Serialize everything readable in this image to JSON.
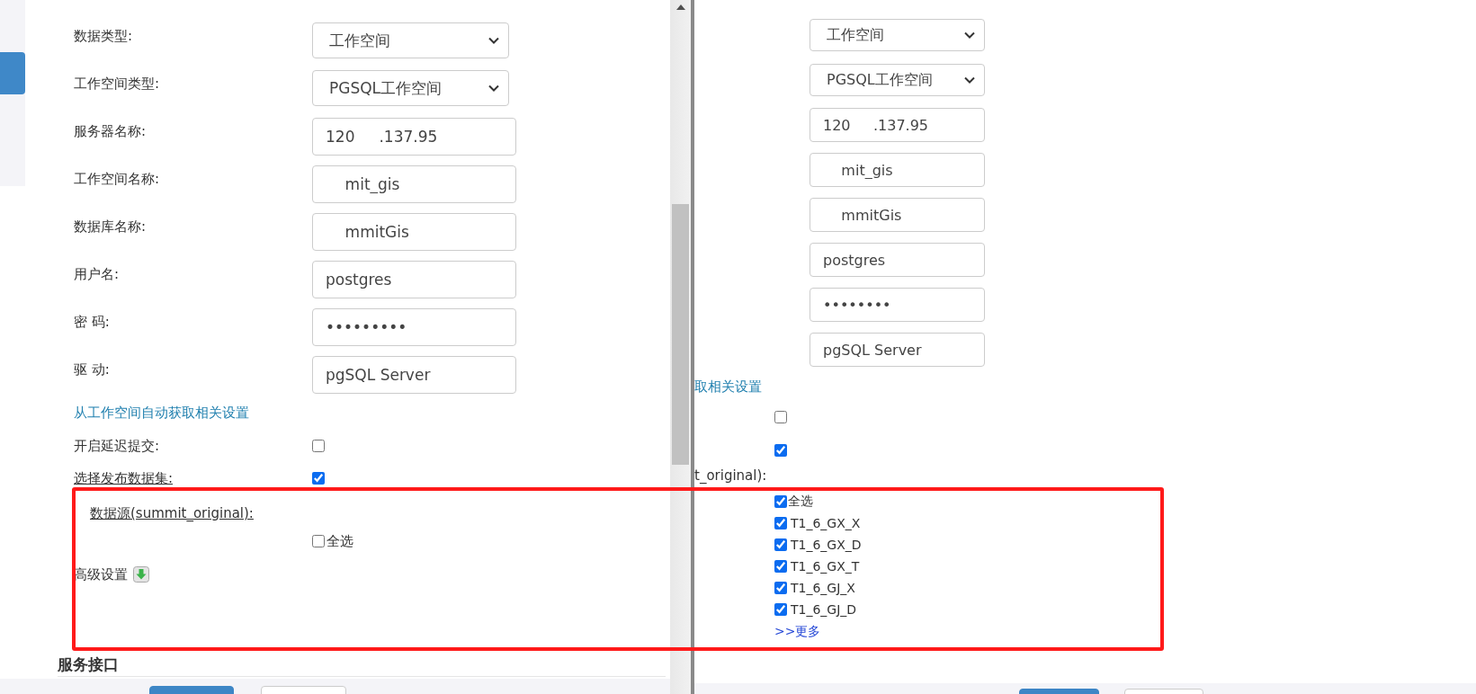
{
  "left_panel": {
    "fields": [
      {
        "label": "数据类型:",
        "kind": "select",
        "value": "工作空间"
      },
      {
        "label": "工作空间类型:",
        "kind": "select",
        "value": "PGSQL工作空间"
      },
      {
        "label": "服务器名称:",
        "kind": "input",
        "value": "120     .137.95"
      },
      {
        "label": "工作空间名称:",
        "kind": "input",
        "value": "    mit_gis"
      },
      {
        "label": "数据库名称:",
        "kind": "input",
        "value": "    mmitGis"
      },
      {
        "label": "用户名:",
        "kind": "input",
        "value": "postgres"
      },
      {
        "label": "密 码:",
        "kind": "input",
        "value": "•••••••••"
      },
      {
        "label": "驱 动:",
        "kind": "input",
        "value": "pgSQL Server"
      }
    ],
    "link": "从工作空间自动获取相关设置",
    "options": [
      {
        "label": "开启延迟提交:",
        "checked": false
      },
      {
        "label": "选择发布数据集:",
        "checked": true
      }
    ],
    "datasource_label": "数据源(summit_original):",
    "select_all": {
      "label": "全选",
      "checked": false
    },
    "advanced": "高级设置",
    "section_title": "服务接口"
  },
  "right_panel": {
    "fields": [
      {
        "kind": "select",
        "value": "工作空间"
      },
      {
        "kind": "select",
        "value": "PGSQL工作空间"
      },
      {
        "kind": "input",
        "value": "120     .137.95"
      },
      {
        "kind": "input",
        "value": "    mit_gis"
      },
      {
        "kind": "input",
        "value": "    mmitGis"
      },
      {
        "kind": "input",
        "value": "postgres"
      },
      {
        "kind": "input",
        "value": "••••••••"
      },
      {
        "kind": "input",
        "value": "pgSQL Server"
      }
    ],
    "link": "取相关设置",
    "options": [
      {
        "checked": false
      },
      {
        "checked": true
      }
    ],
    "datasource_label": "t_original):",
    "datasets": [
      {
        "label": "全选",
        "checked": true
      },
      {
        "label": "T1_6_GX_X",
        "checked": true
      },
      {
        "label": "T1_6_GX_D",
        "checked": true
      },
      {
        "label": "T1_6_GX_T",
        "checked": true
      },
      {
        "label": "T1_6_GJ_X",
        "checked": true
      },
      {
        "label": "T1_6_GJ_D",
        "checked": true
      }
    ],
    "more_link": ">>更多"
  }
}
